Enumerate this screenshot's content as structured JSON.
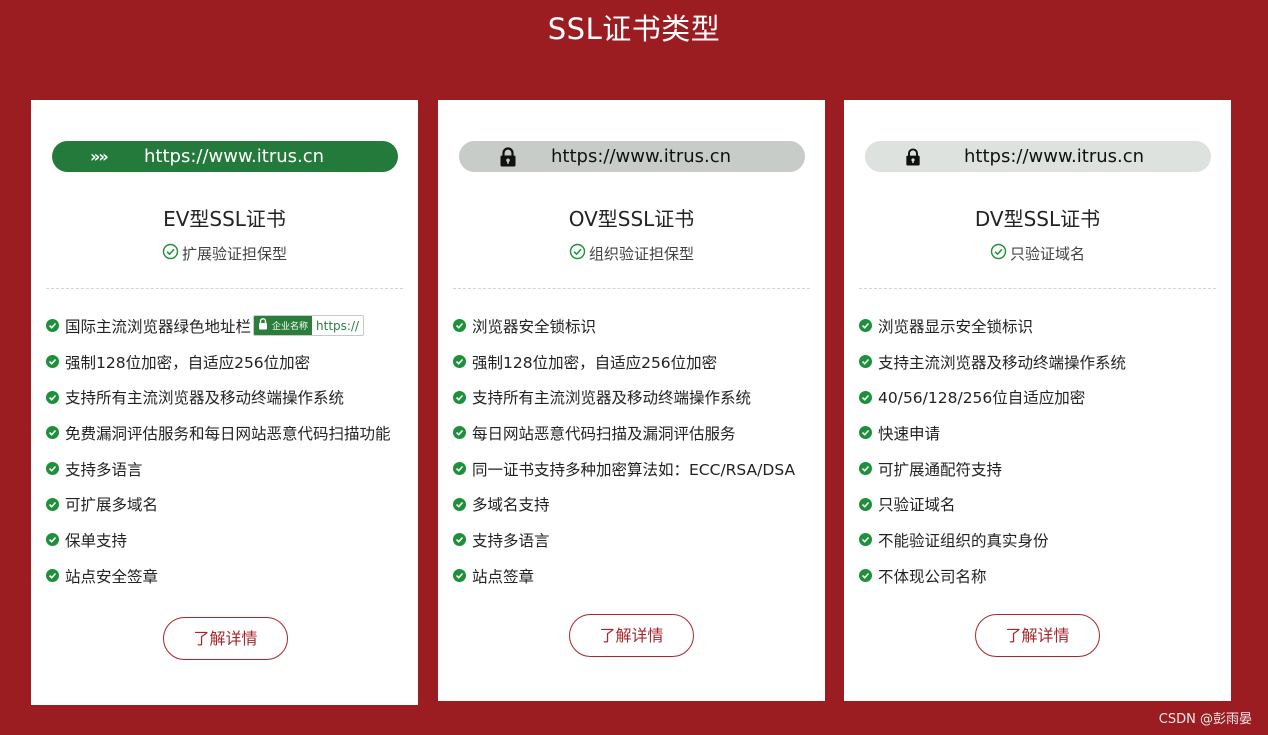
{
  "page_title": "SSL证书类型",
  "watermark": "CSDN @彭雨晏",
  "colors": {
    "background": "#9b1c21",
    "ev_bar": "#237a3b",
    "check": "#1e8f3a",
    "button": "#a8262b"
  },
  "cards": [
    {
      "bar_icon": "double-chevron-icon",
      "bar_chevrons": "»»",
      "url": "https://www.itrus.cn",
      "title": "EV型SSL证书",
      "subtitle": "扩展验证担保型",
      "features": [
        "国际主流浏览器绿色地址栏",
        "强制128位加密，自适应256位加密",
        "支持所有主流浏览器及移动终端操作系统",
        "免费漏洞评估服务和每日网站恶意代码扫描功能",
        "支持多语言",
        "可扩展多域名",
        "保单支持",
        "站点安全签章"
      ],
      "badge": {
        "name": "企业名称",
        "url": "https://"
      },
      "button_label": "了解详情"
    },
    {
      "bar_icon": "lock-icon",
      "url": "https://www.itrus.cn",
      "title": "OV型SSL证书",
      "subtitle": "组织验证担保型",
      "features": [
        "浏览器安全锁标识",
        "强制128位加密，自适应256位加密",
        "支持所有主流浏览器及移动终端操作系统",
        "每日网站恶意代码扫描及漏洞评估服务",
        "同一证书支持多种加密算法如：ECC/RSA/DSA",
        "多域名支持",
        "支持多语言",
        "站点签章"
      ],
      "button_label": "了解详情"
    },
    {
      "bar_icon": "lock-icon",
      "url": "https://www.itrus.cn",
      "title": "DV型SSL证书",
      "subtitle": "只验证域名",
      "features": [
        "浏览器显示安全锁标识",
        "支持主流浏览器及移动终端操作系统",
        "40/56/128/256位自适应加密",
        "快速申请",
        "可扩展通配符支持",
        "只验证域名",
        "不能验证组织的真实身份",
        "不体现公司名称"
      ],
      "button_label": "了解详情"
    }
  ]
}
